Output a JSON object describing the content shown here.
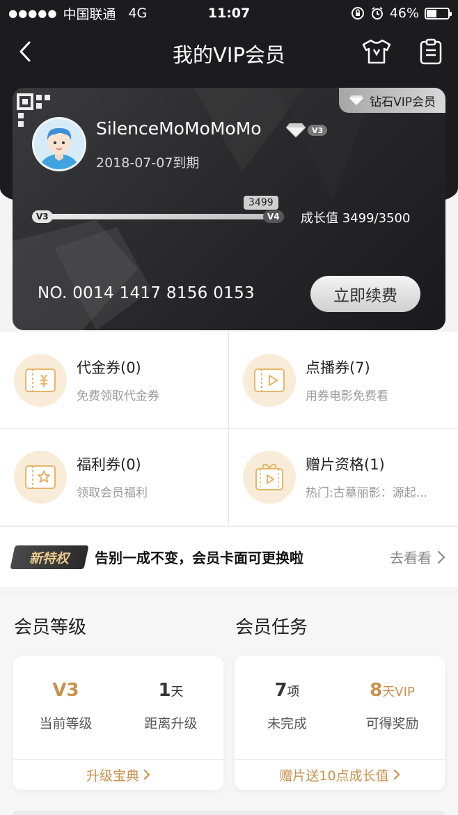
{
  "status_bar": {
    "carrier": "中国联通",
    "network": "4G",
    "time": "11:07",
    "battery": "46%",
    "battery_level": 0.46
  },
  "nav": {
    "title": "我的VIP会员"
  },
  "card": {
    "tag": "钻石VIP会员",
    "username": "SilenceMoMoMoMo",
    "level_badge": "V3",
    "expire": "2018-07-07到期",
    "progress": {
      "current": 3499,
      "target": 3500,
      "bubble": "3499",
      "from_level": "V3",
      "to_level": "V4"
    },
    "growth_label": "成长值 3499/3500",
    "card_number": "NO. 0014 1417 8156 0153",
    "renew_button": "立即续费"
  },
  "coupons": [
    {
      "title": "代金券(0)",
      "subtitle": "免费领取代金券",
      "icon": "yuan-ticket-icon"
    },
    {
      "title": "点播券(7)",
      "subtitle": "用券电影免费看",
      "icon": "play-ticket-icon"
    },
    {
      "title": "福利券(0)",
      "subtitle": "领取会员福利",
      "icon": "star-ticket-icon"
    },
    {
      "title": "赠片资格(1)",
      "subtitle": "热门:古墓丽影：源起...",
      "icon": "gift-film-icon"
    }
  ],
  "privilege": {
    "badge": "新特权",
    "text": "告别一成不变，会员卡面可更换啦",
    "link": "去看看"
  },
  "member_level": {
    "title": "会员等级",
    "stats": [
      {
        "value": "V3",
        "unit": "",
        "label": "当前等级"
      },
      {
        "value": "1",
        "unit": "天",
        "label": "距离升级"
      }
    ],
    "link": "升级宝典"
  },
  "member_tasks": {
    "title": "会员任务",
    "stats": [
      {
        "value": "7",
        "unit": "项",
        "label": "未完成"
      },
      {
        "value": "8",
        "unit": "天VIP",
        "label": "可得奖励"
      }
    ],
    "link": "赠片送10点成长值"
  },
  "colors": {
    "gold": "#c8914c",
    "dark_bg": "#1c1c1e",
    "coupon_circle": "#f8ecd9"
  }
}
